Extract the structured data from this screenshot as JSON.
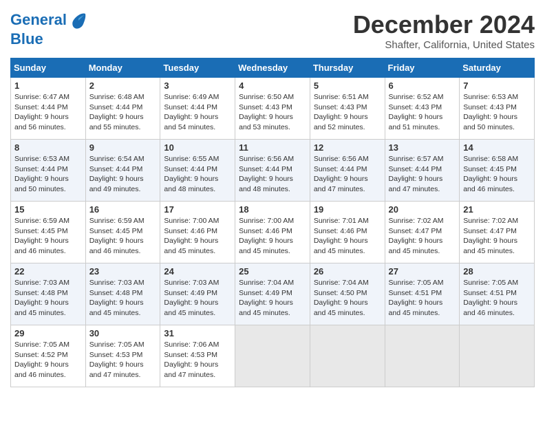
{
  "header": {
    "logo_line1": "General",
    "logo_line2": "Blue",
    "month_title": "December 2024",
    "location": "Shafter, California, United States"
  },
  "weekdays": [
    "Sunday",
    "Monday",
    "Tuesday",
    "Wednesday",
    "Thursday",
    "Friday",
    "Saturday"
  ],
  "weeks": [
    [
      {
        "day": "1",
        "sunrise": "6:47 AM",
        "sunset": "4:44 PM",
        "daylight": "9 hours and 56 minutes."
      },
      {
        "day": "2",
        "sunrise": "6:48 AM",
        "sunset": "4:44 PM",
        "daylight": "9 hours and 55 minutes."
      },
      {
        "day": "3",
        "sunrise": "6:49 AM",
        "sunset": "4:44 PM",
        "daylight": "9 hours and 54 minutes."
      },
      {
        "day": "4",
        "sunrise": "6:50 AM",
        "sunset": "4:43 PM",
        "daylight": "9 hours and 53 minutes."
      },
      {
        "day": "5",
        "sunrise": "6:51 AM",
        "sunset": "4:43 PM",
        "daylight": "9 hours and 52 minutes."
      },
      {
        "day": "6",
        "sunrise": "6:52 AM",
        "sunset": "4:43 PM",
        "daylight": "9 hours and 51 minutes."
      },
      {
        "day": "7",
        "sunrise": "6:53 AM",
        "sunset": "4:43 PM",
        "daylight": "9 hours and 50 minutes."
      }
    ],
    [
      {
        "day": "8",
        "sunrise": "6:53 AM",
        "sunset": "4:44 PM",
        "daylight": "9 hours and 50 minutes."
      },
      {
        "day": "9",
        "sunrise": "6:54 AM",
        "sunset": "4:44 PM",
        "daylight": "9 hours and 49 minutes."
      },
      {
        "day": "10",
        "sunrise": "6:55 AM",
        "sunset": "4:44 PM",
        "daylight": "9 hours and 48 minutes."
      },
      {
        "day": "11",
        "sunrise": "6:56 AM",
        "sunset": "4:44 PM",
        "daylight": "9 hours and 48 minutes."
      },
      {
        "day": "12",
        "sunrise": "6:56 AM",
        "sunset": "4:44 PM",
        "daylight": "9 hours and 47 minutes."
      },
      {
        "day": "13",
        "sunrise": "6:57 AM",
        "sunset": "4:44 PM",
        "daylight": "9 hours and 47 minutes."
      },
      {
        "day": "14",
        "sunrise": "6:58 AM",
        "sunset": "4:45 PM",
        "daylight": "9 hours and 46 minutes."
      }
    ],
    [
      {
        "day": "15",
        "sunrise": "6:59 AM",
        "sunset": "4:45 PM",
        "daylight": "9 hours and 46 minutes."
      },
      {
        "day": "16",
        "sunrise": "6:59 AM",
        "sunset": "4:45 PM",
        "daylight": "9 hours and 46 minutes."
      },
      {
        "day": "17",
        "sunrise": "7:00 AM",
        "sunset": "4:46 PM",
        "daylight": "9 hours and 45 minutes."
      },
      {
        "day": "18",
        "sunrise": "7:00 AM",
        "sunset": "4:46 PM",
        "daylight": "9 hours and 45 minutes."
      },
      {
        "day": "19",
        "sunrise": "7:01 AM",
        "sunset": "4:46 PM",
        "daylight": "9 hours and 45 minutes."
      },
      {
        "day": "20",
        "sunrise": "7:02 AM",
        "sunset": "4:47 PM",
        "daylight": "9 hours and 45 minutes."
      },
      {
        "day": "21",
        "sunrise": "7:02 AM",
        "sunset": "4:47 PM",
        "daylight": "9 hours and 45 minutes."
      }
    ],
    [
      {
        "day": "22",
        "sunrise": "7:03 AM",
        "sunset": "4:48 PM",
        "daylight": "9 hours and 45 minutes."
      },
      {
        "day": "23",
        "sunrise": "7:03 AM",
        "sunset": "4:48 PM",
        "daylight": "9 hours and 45 minutes."
      },
      {
        "day": "24",
        "sunrise": "7:03 AM",
        "sunset": "4:49 PM",
        "daylight": "9 hours and 45 minutes."
      },
      {
        "day": "25",
        "sunrise": "7:04 AM",
        "sunset": "4:49 PM",
        "daylight": "9 hours and 45 minutes."
      },
      {
        "day": "26",
        "sunrise": "7:04 AM",
        "sunset": "4:50 PM",
        "daylight": "9 hours and 45 minutes."
      },
      {
        "day": "27",
        "sunrise": "7:05 AM",
        "sunset": "4:51 PM",
        "daylight": "9 hours and 45 minutes."
      },
      {
        "day": "28",
        "sunrise": "7:05 AM",
        "sunset": "4:51 PM",
        "daylight": "9 hours and 46 minutes."
      }
    ],
    [
      {
        "day": "29",
        "sunrise": "7:05 AM",
        "sunset": "4:52 PM",
        "daylight": "9 hours and 46 minutes."
      },
      {
        "day": "30",
        "sunrise": "7:05 AM",
        "sunset": "4:53 PM",
        "daylight": "9 hours and 47 minutes."
      },
      {
        "day": "31",
        "sunrise": "7:06 AM",
        "sunset": "4:53 PM",
        "daylight": "9 hours and 47 minutes."
      },
      null,
      null,
      null,
      null
    ]
  ]
}
